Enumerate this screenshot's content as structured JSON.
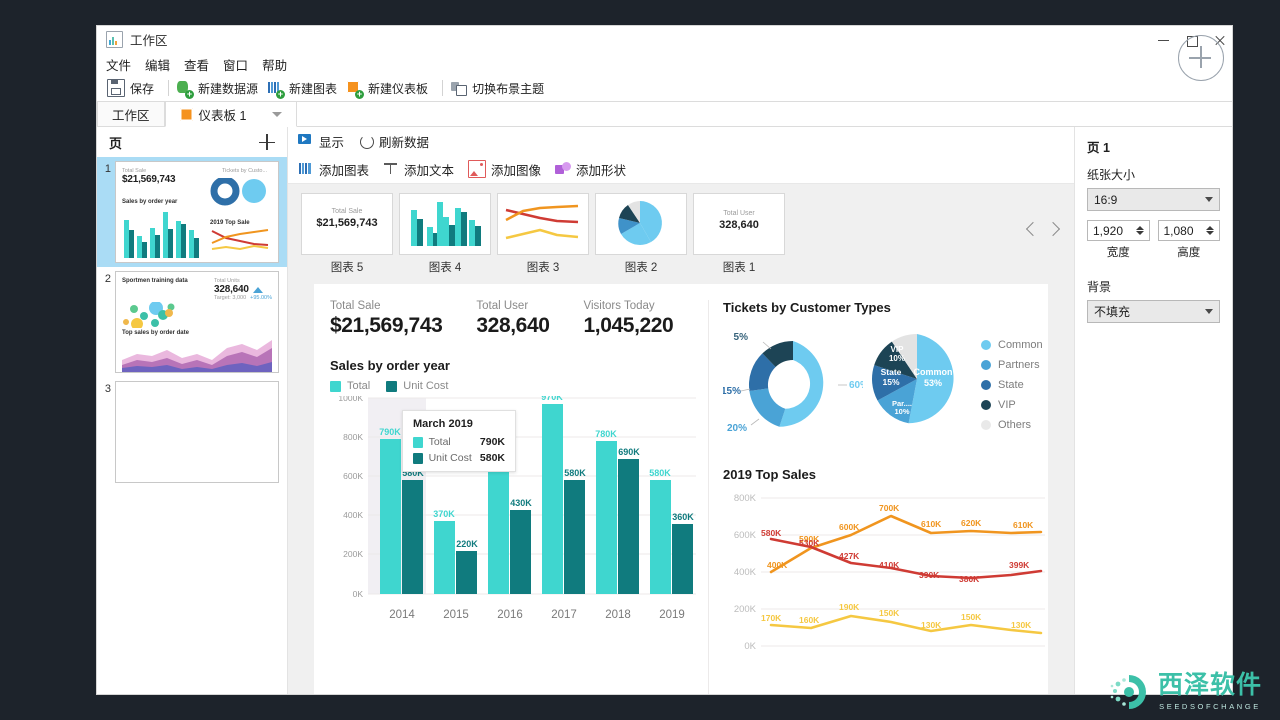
{
  "window": {
    "title": "工作区",
    "icon": "app-chart-icon",
    "controls": {
      "minimize": "−",
      "maximize": "□",
      "close": "×"
    }
  },
  "menubar": {
    "items": [
      "文件",
      "编辑",
      "查看",
      "窗口",
      "帮助"
    ]
  },
  "toolbar": {
    "items": [
      {
        "label": "保存",
        "icon": "save-icon"
      },
      {
        "label": "新建数据源",
        "icon": "new-datasource-icon"
      },
      {
        "label": "新建图表",
        "icon": "new-chart-icon"
      },
      {
        "label": "新建仪表板",
        "icon": "new-dashboard-icon"
      },
      {
        "label": "切换布景主题",
        "icon": "switch-theme-icon"
      }
    ]
  },
  "tabs": [
    {
      "label": "工作区",
      "active": false
    },
    {
      "label": "仪表板 1",
      "active": true,
      "icon": "dashboard-icon"
    }
  ],
  "pages_panel": {
    "header": "页",
    "add_label": "+",
    "pages": [
      {
        "number": "1",
        "selected": true,
        "thumb": {
          "kpi_label": "Total Sale",
          "kpi_value": "$21,569,743",
          "chart_title": "Sales by order year",
          "right_title": "Tickets by Custo...",
          "right_sub": "2019 Top Sale"
        }
      },
      {
        "number": "2",
        "selected": false,
        "thumb": {
          "title": "Sportmen training data",
          "kpi_label": "Total Units",
          "kpi_value": "328,640",
          "target": "Target: 3,000",
          "delta": "+95.00%",
          "chart_title": "Top sales by order date"
        }
      },
      {
        "number": "3",
        "selected": false,
        "thumb": {}
      }
    ]
  },
  "canvas_toolbar_1": [
    {
      "label": "显示",
      "icon": "play-show-icon"
    },
    {
      "label": "刷新数据",
      "icon": "refresh-icon"
    }
  ],
  "canvas_toolbar_2": [
    {
      "label": "添加图表",
      "icon": "add-chart-icon"
    },
    {
      "label": "添加文本",
      "icon": "add-text-icon"
    },
    {
      "label": "添加图像",
      "icon": "add-image-icon"
    },
    {
      "label": "添加形状",
      "icon": "add-shape-icon"
    }
  ],
  "gallery": {
    "items": [
      {
        "caption": "图表 5",
        "type": "kpi",
        "kpi_label": "Total Sale",
        "kpi_value": "$21,569,743"
      },
      {
        "caption": "图表 4",
        "type": "bar"
      },
      {
        "caption": "图表 3",
        "type": "line"
      },
      {
        "caption": "图表 2",
        "type": "pie"
      },
      {
        "caption": "图表 1",
        "type": "kpi",
        "kpi_label": "Total User",
        "kpi_value": "328,640"
      }
    ],
    "prev": "‹",
    "next": "›"
  },
  "dashboard": {
    "kpis": [
      {
        "label": "Total Sale",
        "value": "$21,569,743"
      },
      {
        "label": "Total User",
        "value": "328,640"
      },
      {
        "label": "Visitors Today",
        "value": "1,045,220"
      }
    ],
    "tooltip": {
      "title": "March 2019",
      "rows": [
        {
          "name": "Total",
          "value": "790K",
          "color": "#3fd6cf"
        },
        {
          "name": "Unit Cost",
          "value": "580K",
          "color": "#107b7e"
        }
      ]
    }
  },
  "chart_data": [
    {
      "type": "bar",
      "title": "Sales by order year",
      "categories": [
        "2014",
        "2015",
        "2016",
        "2017",
        "2018",
        "2019"
      ],
      "series": [
        {
          "name": "Total",
          "color": "#3fd6cf",
          "values": [
            790,
            370,
            620,
            970,
            780,
            580
          ],
          "labels": [
            "790K",
            "370K",
            "620K",
            "970K",
            "780K",
            "580K"
          ]
        },
        {
          "name": "Unit Cost",
          "color": "#107b7e",
          "values": [
            580,
            220,
            430,
            580,
            690,
            360
          ],
          "labels": [
            "580K",
            "220K",
            "430K",
            "580K",
            "690K",
            "360K"
          ]
        }
      ],
      "ylim": [
        0,
        1000
      ],
      "yticks": [
        "0K",
        "200K",
        "400K",
        "600K",
        "800K",
        "1000K"
      ],
      "ylabel": "",
      "xlabel": "",
      "grid": true,
      "legend": "top"
    },
    {
      "type": "pie",
      "title": "Tickets by Customer Types",
      "subtype": "donut",
      "labels": [
        "60%",
        "20%",
        "15%",
        "5%"
      ],
      "values": [
        60,
        20,
        15,
        5
      ],
      "colors": [
        "#6ecbf0",
        "#4aa3d6",
        "#2e6fa8",
        "#1d4455"
      ]
    },
    {
      "type": "pie",
      "title": "Tickets by Customer Types",
      "categories": [
        "Common",
        "Partners",
        "State",
        "VIP",
        "Others"
      ],
      "values": [
        53,
        10,
        15,
        10,
        12
      ],
      "labels": [
        "Common 53%",
        "Par... 10%",
        "State 15%",
        "VIP 10%",
        "Others"
      ],
      "colors": [
        "#6ecbf0",
        "#4aa3d6",
        "#2e6fa8",
        "#1d4455",
        "#e3e3e3"
      ],
      "legend": [
        "Common",
        "Partners",
        "State",
        "VIP",
        "Others"
      ]
    },
    {
      "type": "line",
      "title": "2019 Top Sales",
      "ylim": [
        0,
        800
      ],
      "yticks": [
        "0K",
        "200K",
        "400K",
        "600K",
        "800K"
      ],
      "x": [
        1,
        2,
        3,
        4,
        5,
        6,
        7,
        8
      ],
      "series": [
        {
          "name": "orange",
          "color": "#f0951f",
          "values": [
            410,
            530,
            600,
            700,
            610,
            620,
            610,
            610
          ],
          "labels": [
            "400K",
            "590K",
            "600K",
            "700K",
            "610K",
            "620K",
            "610K"
          ]
        },
        {
          "name": "red",
          "color": "#cf3b34",
          "values": [
            580,
            530,
            427,
            410,
            390,
            380,
            399,
            399
          ],
          "labels": [
            "580K",
            "530K",
            "427K",
            "410K",
            "390K",
            "380K",
            "399K"
          ]
        },
        {
          "name": "yellow",
          "color": "#f5c842",
          "values": [
            170,
            160,
            190,
            150,
            130,
            150,
            130,
            130
          ],
          "labels": [
            "170K",
            "160K",
            "190K",
            "150K",
            "130K",
            "150K",
            "130K"
          ]
        }
      ],
      "grid": true
    }
  ],
  "properties": {
    "title": "页 1",
    "paper_size_label": "纸张大小",
    "paper_size_value": "16:9",
    "width_value": "1,920",
    "height_value": "1,080",
    "width_label": "宽度",
    "height_label": "高度",
    "background_label": "背景",
    "background_value": "不填充"
  },
  "logo": {
    "text": "西泽软件",
    "subtitle": "SEEDSOFCHANGE",
    "color": "#3cc0a8"
  }
}
